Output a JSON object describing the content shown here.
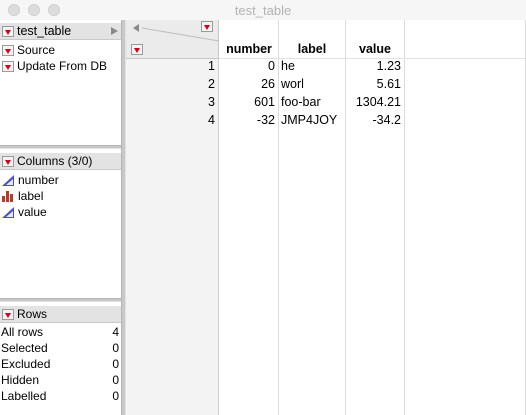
{
  "window": {
    "title": "test_table"
  },
  "table_panel": {
    "name": "test_table",
    "scripts": [
      {
        "label": "Source"
      },
      {
        "label": "Update From DB"
      }
    ]
  },
  "columns_panel": {
    "title": "Columns (3/0)",
    "columns": [
      {
        "name": "number",
        "icon": "continuous-icon"
      },
      {
        "name": "label",
        "icon": "nominal-icon"
      },
      {
        "name": "value",
        "icon": "continuous-icon"
      }
    ]
  },
  "rows_panel": {
    "title": "Rows",
    "stats": [
      {
        "label": "All rows",
        "value": "4"
      },
      {
        "label": "Selected",
        "value": "0"
      },
      {
        "label": "Excluded",
        "value": "0"
      },
      {
        "label": "Hidden",
        "value": "0"
      },
      {
        "label": "Labelled",
        "value": "0"
      }
    ]
  },
  "grid": {
    "headers": [
      "number",
      "label",
      "value"
    ],
    "rows": [
      {
        "row": "1",
        "number": "0",
        "label": "he",
        "value": "1.23"
      },
      {
        "row": "2",
        "number": "26",
        "label": "worl",
        "value": "5.61"
      },
      {
        "row": "3",
        "number": "601",
        "label": "foo-bar",
        "value": "1304.21"
      },
      {
        "row": "4",
        "number": "-32",
        "label": "JMP4JOY",
        "value": "-34.2"
      }
    ]
  },
  "colors": {
    "menu_triangle": "#d0021b",
    "continuous_icon": "#4a4fc7",
    "nominal_icon": "#b83a2b"
  }
}
